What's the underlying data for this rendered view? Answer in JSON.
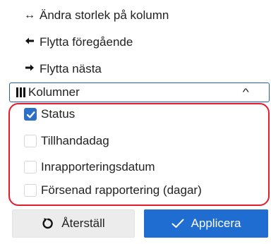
{
  "menu": {
    "resize": {
      "icon": "left-right-arrow-icon",
      "glyph": "↔",
      "label": "Ändra storlek på kolumn"
    },
    "prev": {
      "icon": "arrow-left-icon",
      "glyph": "🠐",
      "label": "Flytta föregående"
    },
    "next": {
      "icon": "arrow-right-icon",
      "glyph": "🠒",
      "label": "Flytta nästa"
    }
  },
  "columns": {
    "icon": "columns-icon",
    "label": "Kolumner",
    "expanded": true,
    "chevron": "^",
    "options": [
      {
        "label": "Status",
        "checked": true
      },
      {
        "label": "Tillhandadag",
        "checked": false
      },
      {
        "label": "Inrapporteringsdatum",
        "checked": false
      },
      {
        "label": "Försenad rapportering (dagar)",
        "checked": false
      }
    ]
  },
  "buttons": {
    "reset": {
      "icon": "reset-icon",
      "label": "Återställ"
    },
    "apply": {
      "icon": "checkmark-icon",
      "label": "Applicera"
    }
  },
  "colors": {
    "accent": "#1f6dd1",
    "checkbox_checked": "#2c6fc7",
    "highlight": "#e31b2d"
  }
}
